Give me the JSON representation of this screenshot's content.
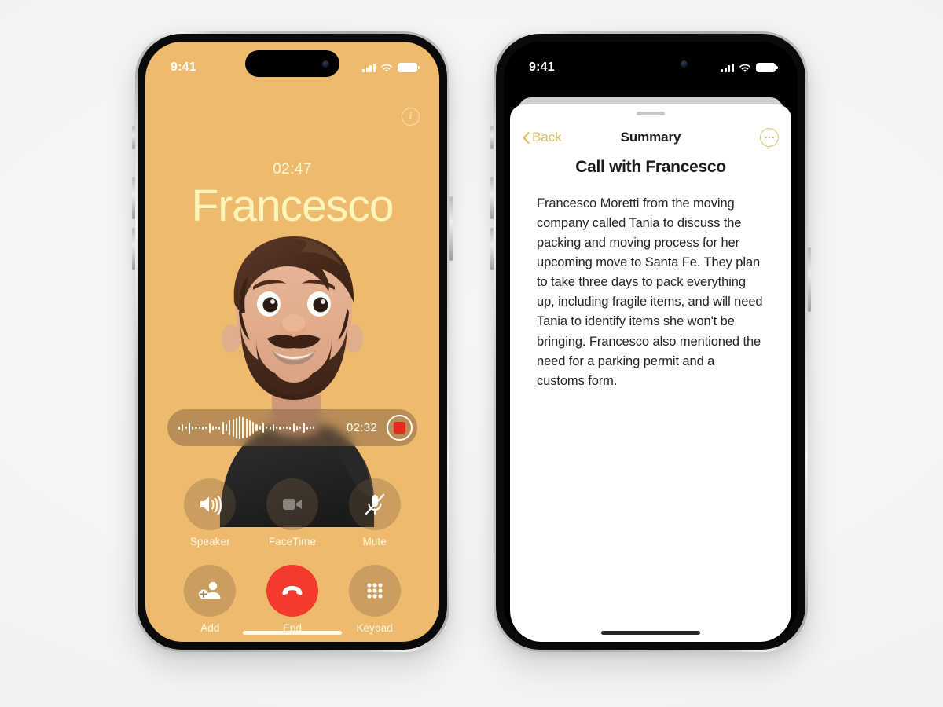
{
  "page": {
    "background_color": "#f6f5f4"
  },
  "colors": {
    "call_background": "#eeba6e",
    "call_name_text": "#fdf4b9",
    "end_call_red": "#f33b2c",
    "record_red": "#e8291f",
    "gold_accent": "#d9bc5c",
    "sheet_white": "#ffffff",
    "status_black": "#000000"
  },
  "call_phone": {
    "status_bar": {
      "time": "9:41",
      "cellular_icon": "signal-bars-icon",
      "wifi_icon": "wifi-icon",
      "battery_icon": "battery-full-icon"
    },
    "info_button": {
      "icon": "info-circle-icon",
      "label": "i"
    },
    "call_timer": "02:47",
    "caller_name": "Francesco",
    "avatar": {
      "icon": "memoji-avatar",
      "description": "Memoji of bearded man in black t-shirt"
    },
    "recording_pill": {
      "waveform_icon": "audio-waveform-icon",
      "waveform_levels": [
        4,
        9,
        3,
        14,
        4,
        3,
        3,
        4,
        3,
        12,
        6,
        3,
        4,
        16,
        9,
        19,
        22,
        26,
        29,
        27,
        24,
        20,
        15,
        9,
        5,
        13,
        3,
        4,
        9,
        3,
        4,
        3,
        3,
        4,
        11,
        6,
        3,
        13,
        4,
        3,
        3
      ],
      "elapsed": "02:32",
      "stop_button": {
        "icon": "stop-record-icon",
        "label": "Stop recording"
      }
    },
    "controls": [
      {
        "id": "speaker",
        "label": "Speaker",
        "icon": "speaker-wave-icon",
        "state": "normal"
      },
      {
        "id": "facetime",
        "label": "FaceTime",
        "icon": "video-camera-icon",
        "state": "disabled"
      },
      {
        "id": "mute",
        "label": "Mute",
        "icon": "microphone-slash-icon",
        "state": "normal"
      },
      {
        "id": "add",
        "label": "Add",
        "icon": "person-add-icon",
        "state": "normal"
      },
      {
        "id": "end",
        "label": "End",
        "icon": "phone-down-icon",
        "state": "destructive"
      },
      {
        "id": "keypad",
        "label": "Keypad",
        "icon": "keypad-grid-icon",
        "state": "normal"
      }
    ],
    "home_indicator": "home-indicator"
  },
  "summary_phone": {
    "status_bar": {
      "time": "9:41",
      "cellular_icon": "signal-bars-icon",
      "wifi_icon": "wifi-icon",
      "battery_icon": "battery-full-icon"
    },
    "sheet": {
      "grabber": "sheet-grabber-handle",
      "nav": {
        "back_label": "Back",
        "back_icon": "chevron-left-icon",
        "title": "Summary",
        "more_icon": "ellipsis-circle-icon"
      },
      "heading": "Call with Francesco",
      "body": "Francesco Moretti from the moving company called Tania to discuss the packing and moving process for her upcoming move to Santa Fe. They plan to take three days to pack everything up, including fragile items, and will need Tania to identify items she won't be bringing. Francesco also mentioned the need for a parking permit and a customs form."
    },
    "home_indicator": "home-indicator"
  }
}
